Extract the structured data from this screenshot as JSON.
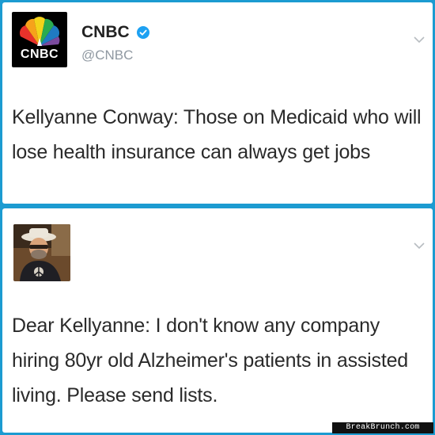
{
  "tweet1": {
    "author_name": "CNBC",
    "handle": "@CNBC",
    "logo_text": "CNBC",
    "text": "Kellyanne Conway: Those on Medicaid who will lose health insurance can always get jobs",
    "avatar_icon": "nbc-peacock-logo-icon",
    "verified_icon": "verified-badge-icon",
    "menu_icon": "chevron-down-icon"
  },
  "tweet2": {
    "text": "Dear Kellyanne: I don't know any company hiring 80yr old Alzheimer's patients in assisted living. Please send lists.",
    "avatar_icon": "user-avatar-photo",
    "menu_icon": "chevron-down-icon"
  },
  "watermark": {
    "text": "BreakBrunch.com"
  },
  "colors": {
    "border": "#1c9bd1",
    "card": "#ffffff",
    "text": "#2a2a2a",
    "handle": "#8f98a1",
    "verified": "#1da1f2"
  }
}
